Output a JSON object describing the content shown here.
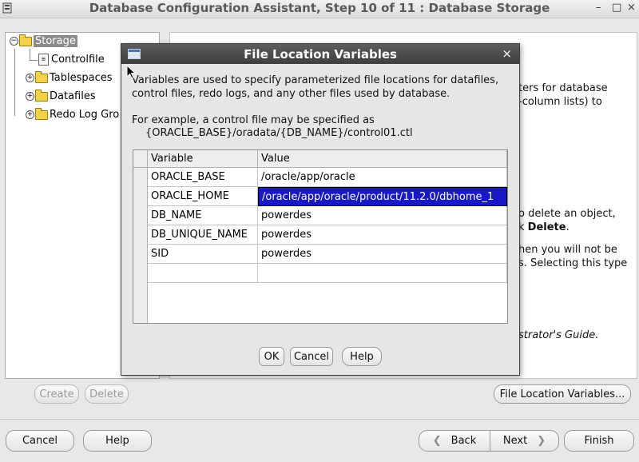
{
  "window": {
    "title": "Database Configuration Assistant, Step 10 of 11 : Database Storage",
    "minimize_glyph": "–",
    "maximize_glyph": "□",
    "close_glyph": "×"
  },
  "tree": {
    "root_label": "Storage",
    "items": [
      {
        "label": "Controlfile"
      },
      {
        "label": "Tablespaces"
      },
      {
        "label": "Datafiles"
      },
      {
        "label": "Redo Log Gro"
      }
    ]
  },
  "content": {
    "lines": [
      "ters for database",
      "-column lists) to",
      "o delete an object,",
      "k",
      "Delete",
      ".",
      "hen you will not be",
      "s. Selecting this type",
      "strator's Guide."
    ]
  },
  "bottom": {
    "create_label": "Create",
    "delete_label": "Delete",
    "file_location_label": "File Location Variables...",
    "cancel_label": "Cancel",
    "help_label": "Help",
    "back_label": "Back",
    "next_label": "Next",
    "finish_label": "Finish",
    "back_glyph": "❮",
    "next_glyph": "❯"
  },
  "dialog": {
    "title": "File Location Variables",
    "close_glyph": "×",
    "description_line1": "Variables are used to specify parameterized file locations for datafiles,",
    "description_line2": "control files, redo logs, and any other files used by database.",
    "example_line1": "For example, a control file may be specified as",
    "example_line2": "{ORACLE_BASE}/oradata/{DB_NAME}/control01.ctl",
    "table": {
      "headers": [
        "Variable",
        "Value"
      ],
      "rows": [
        {
          "variable": "ORACLE_BASE",
          "value": "/oracle/app/oracle"
        },
        {
          "variable": "ORACLE_HOME",
          "value": "/oracle/app/oracle/product/11.2.0/dbhome_1"
        },
        {
          "variable": "DB_NAME",
          "value": "powerdes"
        },
        {
          "variable": "DB_UNIQUE_NAME",
          "value": "powerdes"
        },
        {
          "variable": "SID",
          "value": "powerdes"
        },
        {
          "variable": "",
          "value": ""
        }
      ]
    },
    "ok_label": "OK",
    "cancel_label": "Cancel",
    "help_label": "Help"
  },
  "colors": {
    "selection": "#1818c9",
    "dialog_title_bg": "#3e3e3e"
  }
}
